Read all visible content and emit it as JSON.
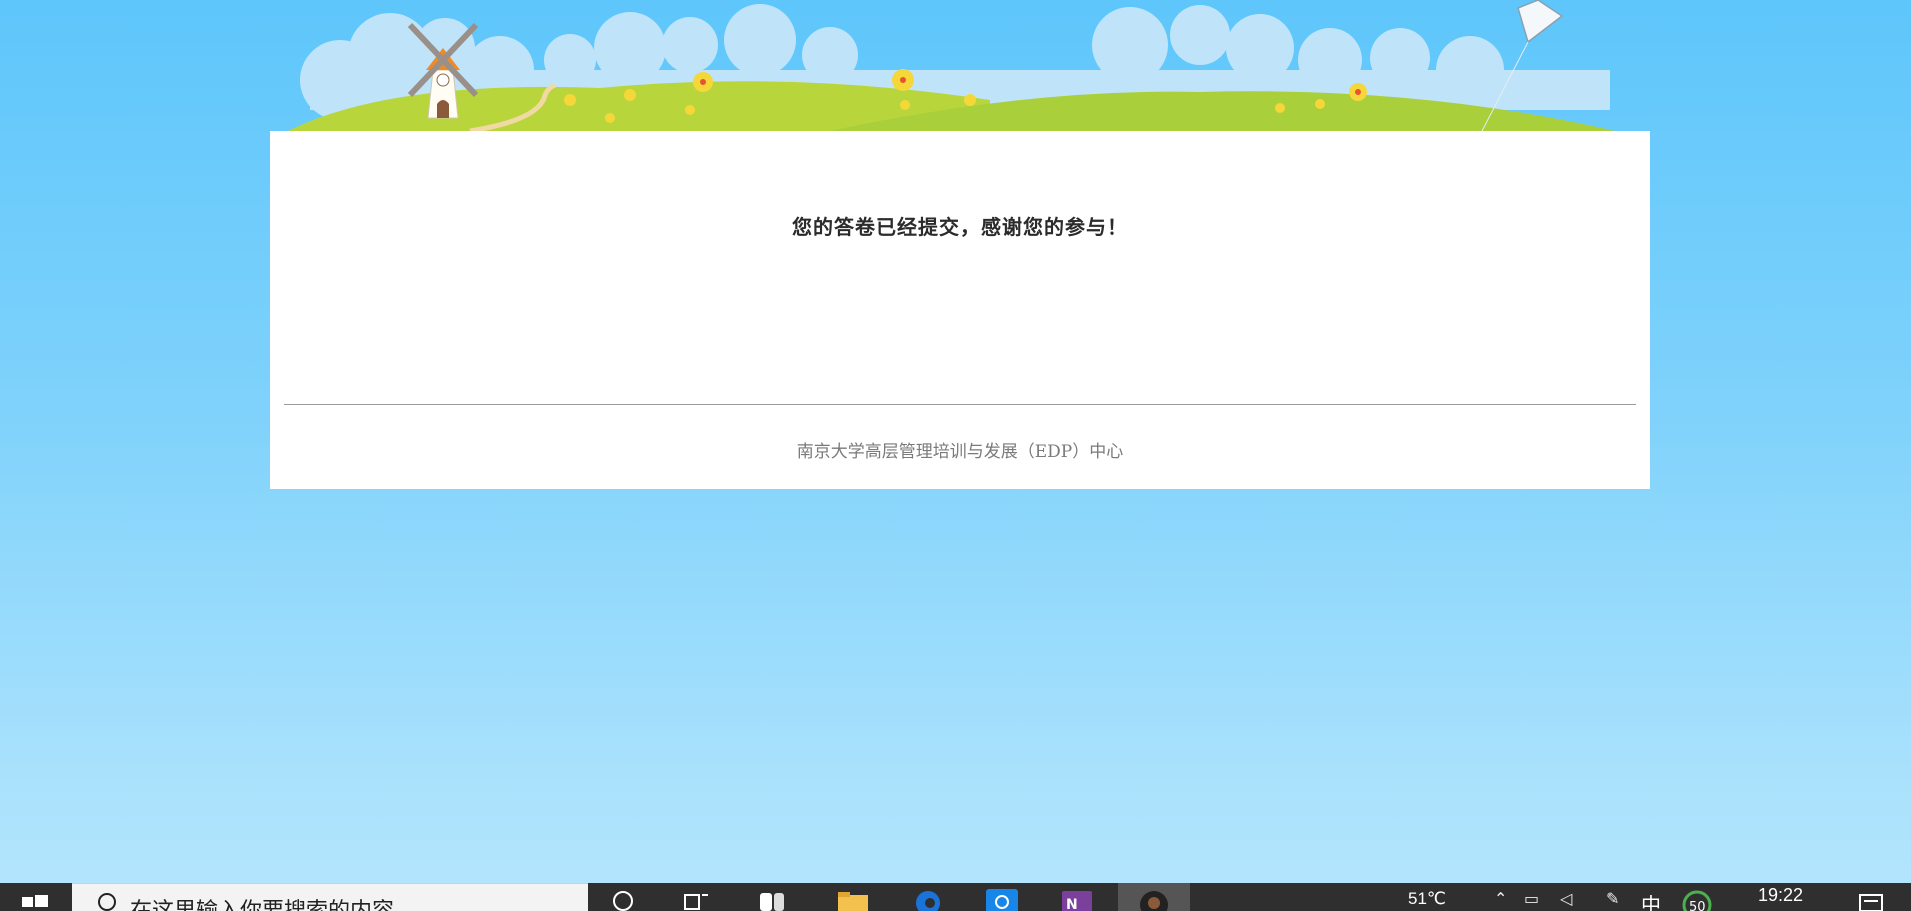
{
  "survey": {
    "message": "您的答卷已经提交，感谢您的参与！",
    "organization": "南京大学高层管理培训与发展（EDP）中心"
  },
  "taskbar": {
    "search_placeholder": "在这里输入你要搜索的内容",
    "weather": "51℃",
    "input_language": "中",
    "clock": "19:22",
    "badge": "50"
  },
  "colors": {
    "sky_top": "#5ec6fb",
    "sky_bottom": "#b5e6fd",
    "grass": "#a9cf3a",
    "card": "#ffffff",
    "taskbar": "#2f2f2f"
  }
}
